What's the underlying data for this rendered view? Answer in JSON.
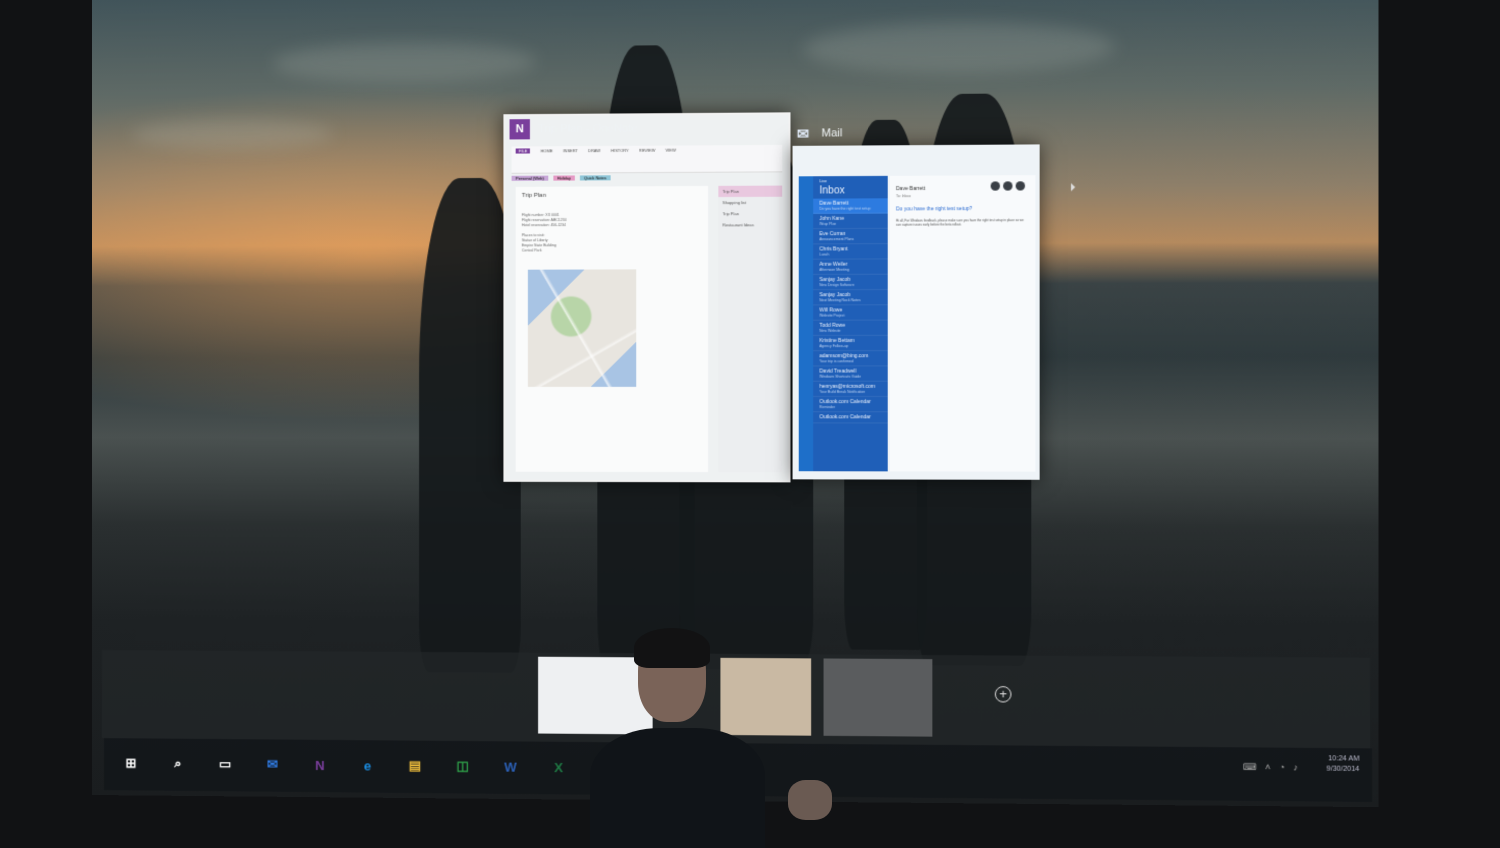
{
  "desktop": {
    "snap_windows": {
      "onenote": {
        "title": "Trip Plan - OneNote",
        "icon": "onenote-icon",
        "ribbon_tabs": [
          "FILE",
          "HOME",
          "INSERT",
          "DRAW",
          "HISTORY",
          "REVIEW",
          "VIEW"
        ],
        "notebook": "Personal (Web)",
        "sections": [
          "Holiday",
          "Quick Notes"
        ],
        "page_title": "Trip Plan",
        "page_lines": [
          "Flight number: XX 0001",
          "Flight reservation: ABC1234",
          "Hotel reservation: 456-1234",
          "",
          "Places to visit:",
          "Statue of Liberty",
          "Empire State Building",
          "Central Park"
        ],
        "pages": [
          "Trip Plan",
          "Shopping list",
          "Trip Plan",
          "Restaurant Ideas"
        ]
      },
      "mail": {
        "title": "Mail",
        "icon": "mail-icon",
        "folder": "Inbox",
        "account": "Live",
        "messages": [
          {
            "name": "Dave Barrett",
            "subject": "Do you have the right test setup"
          },
          {
            "name": "John Kane",
            "subject": "Wrap Plan"
          },
          {
            "name": "Eve Curran",
            "subject": "Announcement Plans"
          },
          {
            "name": "Chris Bryant",
            "subject": "Lunch"
          },
          {
            "name": "Anne Weiler",
            "subject": "Afternoon Meeting"
          },
          {
            "name": "Sanjay Jacob",
            "subject": "New Design Software"
          },
          {
            "name": "Sanjay Jacob",
            "subject": "Next Meeting Rock Notes"
          },
          {
            "name": "Will Rowe",
            "subject": "Website Project"
          },
          {
            "name": "Todd Rowe",
            "subject": "New Website"
          },
          {
            "name": "Kristine Bettam",
            "subject": "Agency Follow-up"
          },
          {
            "name": "adamsom@bing.com",
            "subject": "Your trip is confirmed"
          },
          {
            "name": "David Treadwell",
            "subject": "Windows Shortcuts Guide"
          },
          {
            "name": "henryas@microsoft.com",
            "subject": "Your Build Break Notification"
          },
          {
            "name": "Outlook.com Calendar",
            "subject": "Reminder"
          },
          {
            "name": "Outlook.com Calendar",
            "subject": ""
          }
        ],
        "reading_from": "Dave Barrett",
        "reading_to": "To: Inbox",
        "reading_subject": "Do you have the right test setup?",
        "reading_body": "Hi all, For Windows feedback, please make sure you have the right test setup in place so we can capture issues early before the beta rollout."
      }
    },
    "new_desktop_symbol": "+"
  },
  "taskbar": {
    "icons": [
      {
        "name": "start-icon",
        "glyph": "⊞",
        "color": "#ffffff"
      },
      {
        "name": "search-icon",
        "glyph": "⌕",
        "color": "#ffffff"
      },
      {
        "name": "task-view-icon",
        "glyph": "▭",
        "color": "#ffffff"
      },
      {
        "name": "mail-icon",
        "glyph": "✉",
        "color": "#2f7ae0"
      },
      {
        "name": "onenote-icon",
        "glyph": "N",
        "color": "#7a3e9c"
      },
      {
        "name": "internet-explorer-icon",
        "glyph": "e",
        "color": "#1a8ce0"
      },
      {
        "name": "file-explorer-icon",
        "glyph": "▤",
        "color": "#e7b73a"
      },
      {
        "name": "store-icon",
        "glyph": "◫",
        "color": "#2fa34a"
      },
      {
        "name": "word-icon",
        "glyph": "W",
        "color": "#2b5fb4"
      },
      {
        "name": "excel-icon",
        "glyph": "X",
        "color": "#1f7a44"
      },
      {
        "name": "powerpoint-icon",
        "glyph": "P",
        "color": "#d24726"
      },
      {
        "name": "outlook-icon",
        "glyph": "O",
        "color": "#2b74c9"
      },
      {
        "name": "visio-icon",
        "glyph": "V",
        "color": "#2e5fb8"
      },
      {
        "name": "remote-desktop-icon",
        "glyph": "▦",
        "color": "#4a8ad9"
      }
    ],
    "clock_time": "10:24 AM",
    "clock_date": "9/30/2014"
  },
  "colors": {
    "onenote": "#7a3e9c",
    "mail": "#1f5fb8",
    "taskbar": "#12161a"
  }
}
